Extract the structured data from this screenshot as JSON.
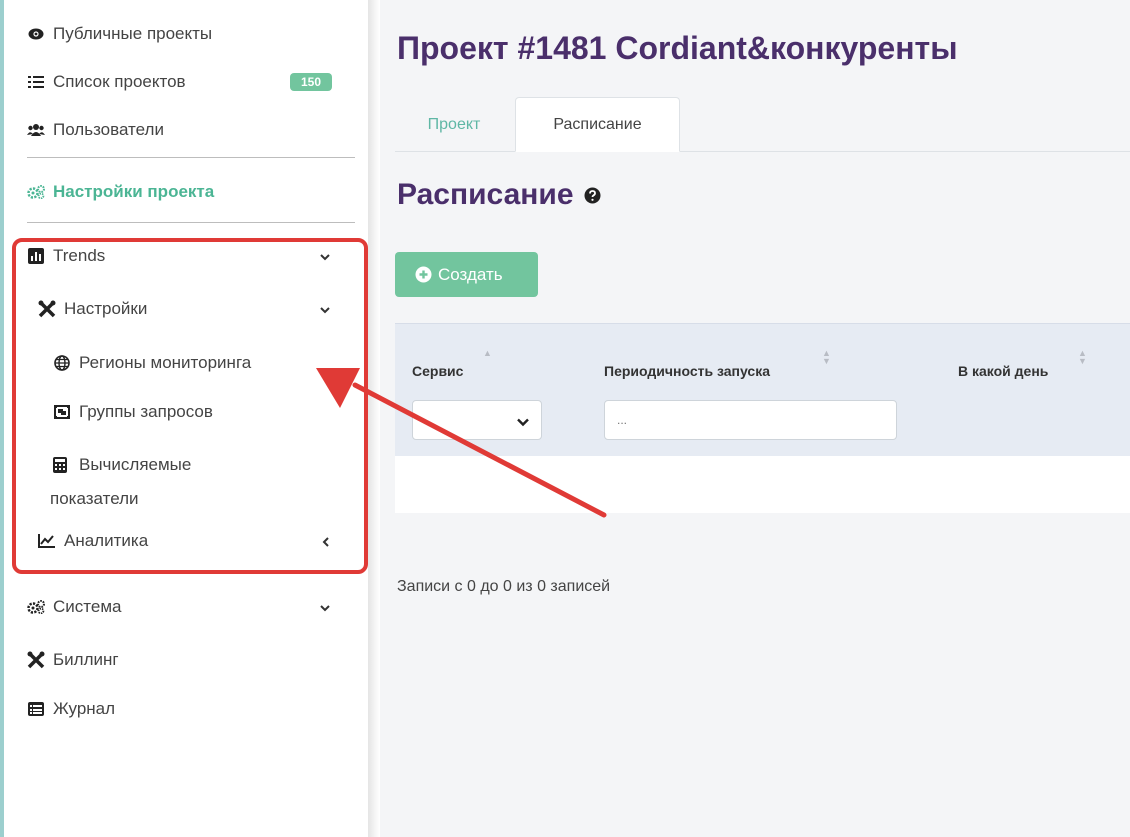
{
  "sidebar": {
    "items": [
      {
        "label": "Публичные проекты",
        "icon": "eye-icon"
      },
      {
        "label": "Список проектов",
        "icon": "list-icon",
        "badge": "150"
      },
      {
        "label": "Пользователи",
        "icon": "users-icon"
      },
      {
        "label": "Настройки проекта",
        "icon": "cogs-icon",
        "active": true
      },
      {
        "label": "Trends",
        "icon": "chart-bar-icon",
        "chevron": "down"
      },
      {
        "label": "Настройки",
        "icon": "tools-icon",
        "chevron": "down"
      },
      {
        "label": "Регионы мониторинга",
        "icon": "globe-icon"
      },
      {
        "label": "Группы запросов",
        "icon": "object-group-icon"
      },
      {
        "label_line1": "Вычисляемые",
        "label_line2": "показатели",
        "icon": "calculator-icon"
      },
      {
        "label": "Аналитика",
        "icon": "chart-line-icon",
        "chevron": "left"
      },
      {
        "label": "Система",
        "icon": "cogs-icon",
        "chevron": "down"
      },
      {
        "label": "Биллинг",
        "icon": "tools-icon"
      },
      {
        "label": "Журнал",
        "icon": "list-alt-icon"
      }
    ]
  },
  "main": {
    "title": "Проект #1481 Cordiant&конкуренты",
    "tabs": [
      {
        "label": "Проект",
        "active": false
      },
      {
        "label": "Расписание",
        "active": true
      }
    ],
    "section_title": "Расписание",
    "create_button": "Создать",
    "table": {
      "columns": [
        "Сервис",
        "Периодичность запуска",
        "В какой день"
      ],
      "filter_input_placeholder": "..."
    },
    "records_info": "Записи с 0 до 0 из 0 записей"
  },
  "colors": {
    "accent_green": "#72c59e",
    "active_green": "#4bb594",
    "title_purple": "#4a2f6b",
    "annotation_red": "#e03a36",
    "table_header_bg": "#e6ebf3"
  }
}
